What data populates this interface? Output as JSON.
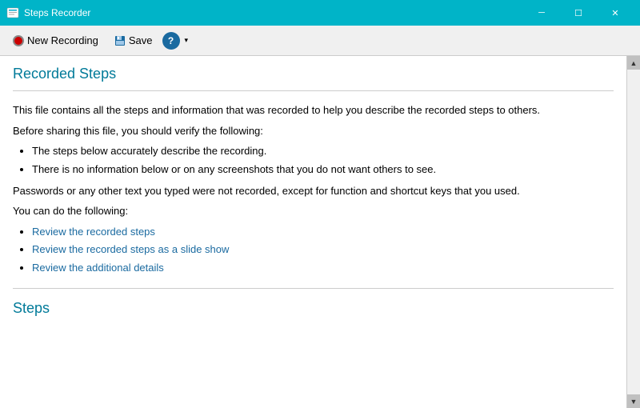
{
  "titleBar": {
    "title": "Steps Recorder",
    "minimizeLabel": "─",
    "maximizeLabel": "☐",
    "closeLabel": "✕"
  },
  "toolbar": {
    "newRecordingLabel": "New Recording",
    "saveLabel": "Save",
    "helpLabel": "?",
    "dropdownArrow": "▾"
  },
  "recordedSteps": {
    "heading": "Recorded Steps",
    "stepsHeading": "Steps",
    "introParagraph1": "This file contains all the steps and information that was recorded to help you describe the recorded steps to others.",
    "introParagraph2": "Before sharing this file, you should verify the following:",
    "verifyItems": [
      "The steps below accurately describe the recording.",
      "There is no information below or on any screenshots that you do not want others to see."
    ],
    "passwordNote": "Passwords or any other text you typed were not recorded, except for function and shortcut keys that you used.",
    "canDoLabel": "You can do the following:",
    "actionLinks": [
      "Review the recorded steps",
      "Review the recorded steps as a slide show",
      "Review the additional details"
    ]
  },
  "scrollbar": {
    "upArrow": "▲",
    "downArrow": "▼"
  }
}
